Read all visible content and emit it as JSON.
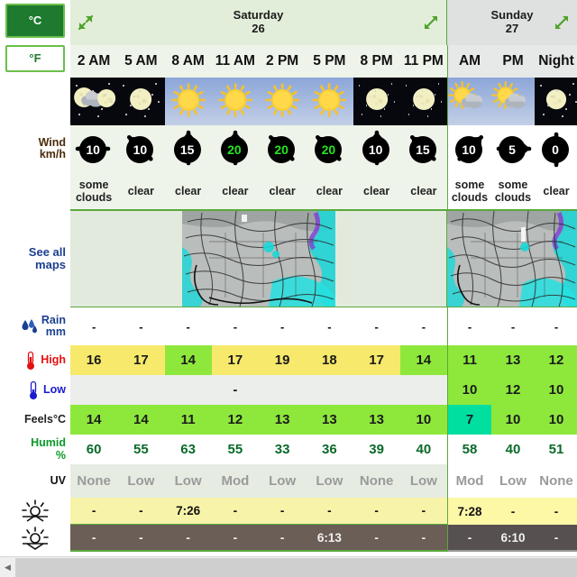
{
  "units": {
    "celsius_label": "°C",
    "fahrenheit_label": "°F",
    "active": "°C"
  },
  "days": [
    {
      "name": "Saturday",
      "date": "26",
      "expand_icon": "collapse-arrows-icon"
    },
    {
      "name": "Sunday",
      "date": "27",
      "expand_icon": "expand-arrows-icon"
    }
  ],
  "columns": {
    "saturday": [
      "2 AM",
      "5 AM",
      "8 AM",
      "11 AM",
      "2 PM",
      "5 PM",
      "8 PM",
      "11 PM"
    ],
    "sunday": [
      "AM",
      "PM",
      "Night"
    ]
  },
  "row_labels": {
    "wind": "Wind",
    "wind_unit": "km/h",
    "maps": "See all\nmaps",
    "maps_line1": "See all",
    "maps_line2": "maps",
    "rain": "Rain",
    "rain_unit": "mm",
    "high": "High",
    "low": "Low",
    "feels": "Feels°C",
    "humid": "Humid",
    "humid_unit": "%",
    "uv": "UV",
    "sunrise_icon": "sunrise-icon",
    "sunset_icon": "sunset-icon"
  },
  "sky_icons": {
    "saturday": [
      "moon-cloud",
      "moon",
      "sun",
      "sun",
      "sun",
      "sun",
      "moon",
      "moon"
    ],
    "sunday": [
      "sun-cloud",
      "sun-cloud",
      "moon"
    ]
  },
  "sky_background": {
    "saturday": [
      "night",
      "night",
      "day",
      "day",
      "day",
      "day",
      "night",
      "night"
    ],
    "sunday": [
      "day",
      "day",
      "night"
    ]
  },
  "wind": {
    "saturday": [
      {
        "speed": "10",
        "dir": "E",
        "color": "white"
      },
      {
        "speed": "10",
        "dir": "SE",
        "color": "white"
      },
      {
        "speed": "15",
        "dir": "S",
        "color": "white"
      },
      {
        "speed": "20",
        "dir": "S",
        "color": "green"
      },
      {
        "speed": "20",
        "dir": "SE",
        "color": "green"
      },
      {
        "speed": "20",
        "dir": "SE",
        "color": "green"
      },
      {
        "speed": "10",
        "dir": "S",
        "color": "white"
      },
      {
        "speed": "15",
        "dir": "SE",
        "color": "white"
      }
    ],
    "sunday": [
      {
        "speed": "10",
        "dir": "SW",
        "color": "white"
      },
      {
        "speed": "5",
        "dir": "W",
        "color": "white"
      },
      {
        "speed": "0",
        "dir": "N",
        "color": "white"
      }
    ]
  },
  "conditions": {
    "saturday": [
      "some clouds",
      "clear",
      "clear",
      "clear",
      "clear",
      "clear",
      "clear",
      "clear"
    ],
    "sunday": [
      "some clouds",
      "some clouds",
      "clear"
    ]
  },
  "rain": {
    "saturday": [
      "-",
      "-",
      "-",
      "-",
      "-",
      "-",
      "-",
      "-"
    ],
    "sunday": [
      "-",
      "-",
      "-"
    ]
  },
  "high": {
    "saturday": [
      "16",
      "17",
      "14",
      "17",
      "19",
      "18",
      "17",
      "14"
    ],
    "sunday": [
      "11",
      "13",
      "12"
    ],
    "saturday_colors": [
      "#f7e96b",
      "#f7e96b",
      "#8ee83c",
      "#f7e96b",
      "#f7e96b",
      "#f7e96b",
      "#f7e96b",
      "#8ee83c"
    ],
    "sunday_colors": [
      "#8ee83c",
      "#8ee83c",
      "#8ee83c"
    ]
  },
  "low": {
    "saturday": [
      "",
      "",
      "",
      "-",
      "",
      "",
      "",
      ""
    ],
    "sunday": [
      "10",
      "12",
      "10"
    ],
    "sunday_colors": [
      "#8ee83c",
      "#8ee83c",
      "#8ee83c"
    ]
  },
  "feels": {
    "saturday": [
      "14",
      "14",
      "11",
      "12",
      "13",
      "13",
      "13",
      "10"
    ],
    "sunday": [
      "7",
      "10",
      "10"
    ],
    "saturday_colors": [
      "#8ee83c",
      "#8ee83c",
      "#8ee83c",
      "#8ee83c",
      "#8ee83c",
      "#8ee83c",
      "#8ee83c",
      "#8ee83c"
    ],
    "sunday_colors": [
      "#00dfa0",
      "#8ee83c",
      "#8ee83c"
    ]
  },
  "humid": {
    "saturday": [
      "60",
      "55",
      "63",
      "55",
      "33",
      "36",
      "39",
      "40"
    ],
    "sunday": [
      "58",
      "40",
      "51"
    ]
  },
  "uv": {
    "saturday": [
      "None",
      "Low",
      "Low",
      "Mod",
      "Low",
      "Low",
      "None",
      "Low"
    ],
    "sunday": [
      "Mod",
      "Low",
      "None"
    ]
  },
  "sunrise": {
    "saturday": [
      "-",
      "-",
      "7:26",
      "-",
      "-",
      "-",
      "-",
      "-"
    ],
    "sunday": [
      "7:28",
      "-",
      "-"
    ]
  },
  "sunset": {
    "saturday": [
      "-",
      "-",
      "-",
      "-",
      "-",
      "6:13",
      "-",
      "-"
    ],
    "sunday": [
      "-",
      "6:10",
      "-"
    ]
  },
  "colors": {
    "accent_green": "#5aa83c",
    "header_green": "#1e7a2e",
    "sat_panel": "#e2eed9",
    "sun_panel": "#dfe0e0",
    "warm_yellow": "#f7e96b",
    "cool_green": "#8ee83c",
    "cold_teal": "#00dfa0",
    "sunrise_band": "#f7f3a8",
    "sunset_band": "#6b5e56"
  },
  "scrollbar": {
    "left_arrow": "◀"
  }
}
